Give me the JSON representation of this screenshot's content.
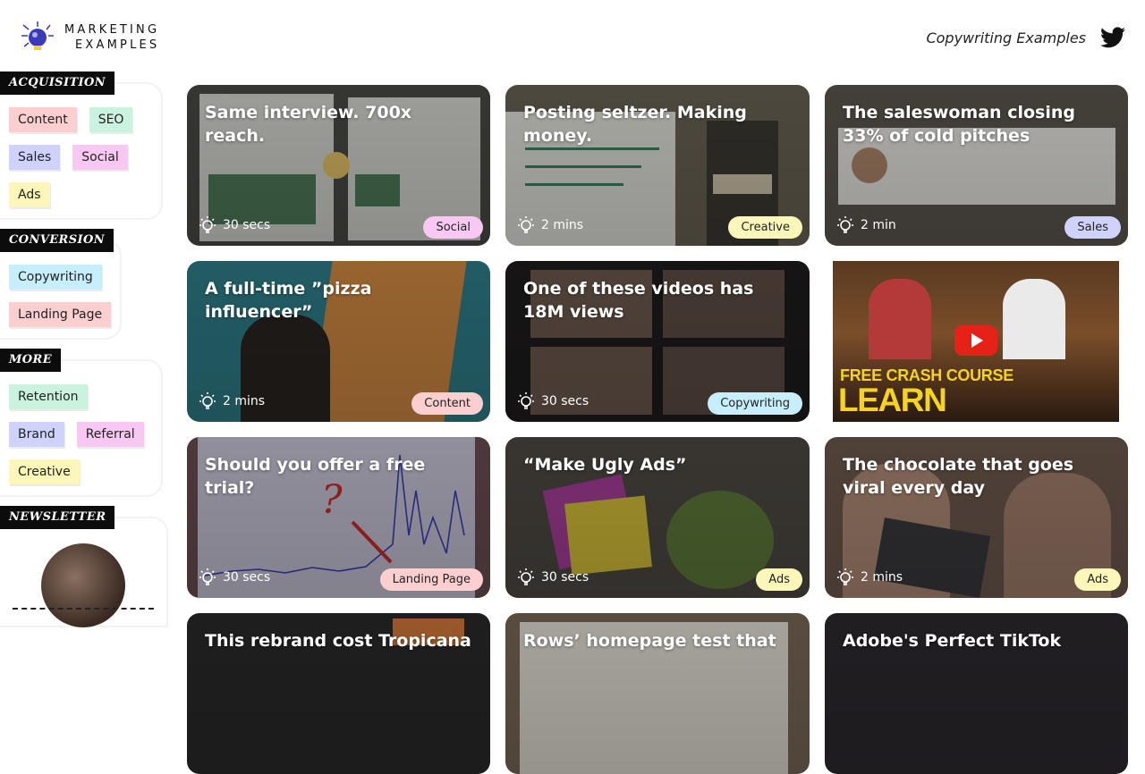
{
  "header": {
    "logo_line1": "MARKETING",
    "logo_line2": "EXAMPLES",
    "nav_link": "Copywriting Examples"
  },
  "sidebar": {
    "acquisition": {
      "label": "ACQUISITION",
      "tags": [
        "Content",
        "SEO",
        "Sales",
        "Social",
        "Ads"
      ]
    },
    "conversion": {
      "label": "CONVERSION",
      "tags": [
        "Copywriting",
        "Landing Page"
      ]
    },
    "more": {
      "label": "MORE",
      "tags": [
        "Retention",
        "Brand",
        "Referral",
        "Creative"
      ]
    },
    "newsletter": {
      "label": "NEWSLETTER"
    }
  },
  "cards": [
    {
      "title": "Same interview. 700x reach.",
      "time": "30 secs",
      "tag": "Social",
      "tag_color": "#f8c8f2"
    },
    {
      "title": "Posting seltzer. Making money.",
      "time": "2 mins",
      "tag": "Creative",
      "tag_color": "#fcf6b9"
    },
    {
      "title": "The saleswoman closing 33% of cold pitches",
      "time": "2 min",
      "tag": "Sales",
      "tag_color": "#cfd3fb"
    },
    {
      "title": "A full-time ”pizza influencer”",
      "time": "2 mins",
      "tag": "Content",
      "tag_color": "#fbcfd0"
    },
    {
      "title": "One of these videos has 18M views",
      "time": "30 secs",
      "tag": "Copywriting",
      "tag_color": "#c6eefc"
    },
    {
      "video_line1": "FREE CRASH COURSE",
      "video_line2": "LEARN COPYWRITING"
    },
    {
      "title": "Should you offer a free trial?",
      "time": "30 secs",
      "tag": "Landing Page",
      "tag_color": "#fbcfd0"
    },
    {
      "title": "“Make Ugly Ads”",
      "time": "30 secs",
      "tag": "Ads",
      "tag_color": "#fcf6b9"
    },
    {
      "title": "The chocolate that goes viral every day",
      "time": "2 mins",
      "tag": "Ads",
      "tag_color": "#fcf6b9"
    },
    {
      "title": "This rebrand cost Tropicana"
    },
    {
      "title": "Rows’ homepage test that"
    },
    {
      "title": "Adobe's Perfect TikTok"
    }
  ]
}
